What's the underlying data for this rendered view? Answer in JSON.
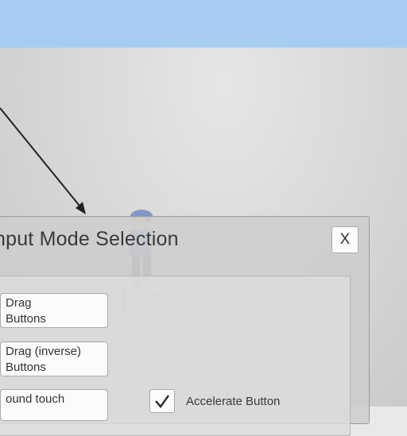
{
  "dialog": {
    "title": "nput Mode Selection",
    "close_label": "X",
    "mode_buttons": [
      {
        "line1": "Drag",
        "line2": "Buttons"
      },
      {
        "line1": "Drag (inverse)",
        "line2": "Buttons"
      },
      {
        "line1": "ound touch",
        "line2": ""
      }
    ],
    "accelerate_label": "Accelerate Button",
    "accelerate_checked": true
  },
  "colors": {
    "sky": "#a8cdf3",
    "panel": "#cdcdcd",
    "button": "#fbfbfb"
  },
  "icons": [
    "arrow-pointer-icon",
    "cyclist-figure",
    "checkmark-icon"
  ]
}
